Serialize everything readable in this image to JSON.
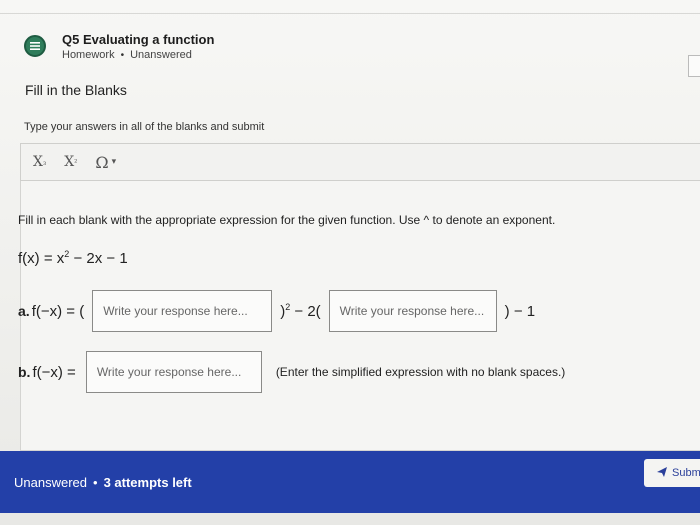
{
  "header": {
    "title": "Q5 Evaluating a function",
    "type": "Homework",
    "separator": "•",
    "status": "Unanswered",
    "icon": "list-icon",
    "icon_color": "#2f7d5b"
  },
  "section": {
    "title": "Fill in the Blanks",
    "instructions": "Type your answers in all of the blanks and submit"
  },
  "toolbar": {
    "subscript_label": "X",
    "subscript_mark": "₃",
    "superscript_label": "X",
    "superscript_mark": "²",
    "symbols_label": "Ω",
    "symbols_caret": "▾"
  },
  "question": {
    "prompt": "Fill in each blank with the appropriate expression for the given function. Use ^ to denote an exponent.",
    "function_lhs": "f(x) = x",
    "function_exp": "2",
    "function_rhs": " − 2x − 1",
    "part_a": {
      "label": "a.",
      "lhs": "f(−x) = (",
      "mid_exp": "2",
      "mid_pre": ")",
      "mid_post": " − 2(",
      "tail": ") − 1",
      "input1_placeholder": "Write your response here...",
      "input2_placeholder": "Write your response here..."
    },
    "part_b": {
      "label": "b.",
      "lhs": "f(−x) =",
      "input_placeholder": "Write your response here...",
      "note": "(Enter the simplified expression with no blank spaces.)"
    }
  },
  "footer": {
    "status": "Unanswered",
    "separator": "•",
    "attempts": "3 attempts left",
    "submit_label": "Subm",
    "submit_icon": "send-icon",
    "bar_color": "#2340a8"
  }
}
